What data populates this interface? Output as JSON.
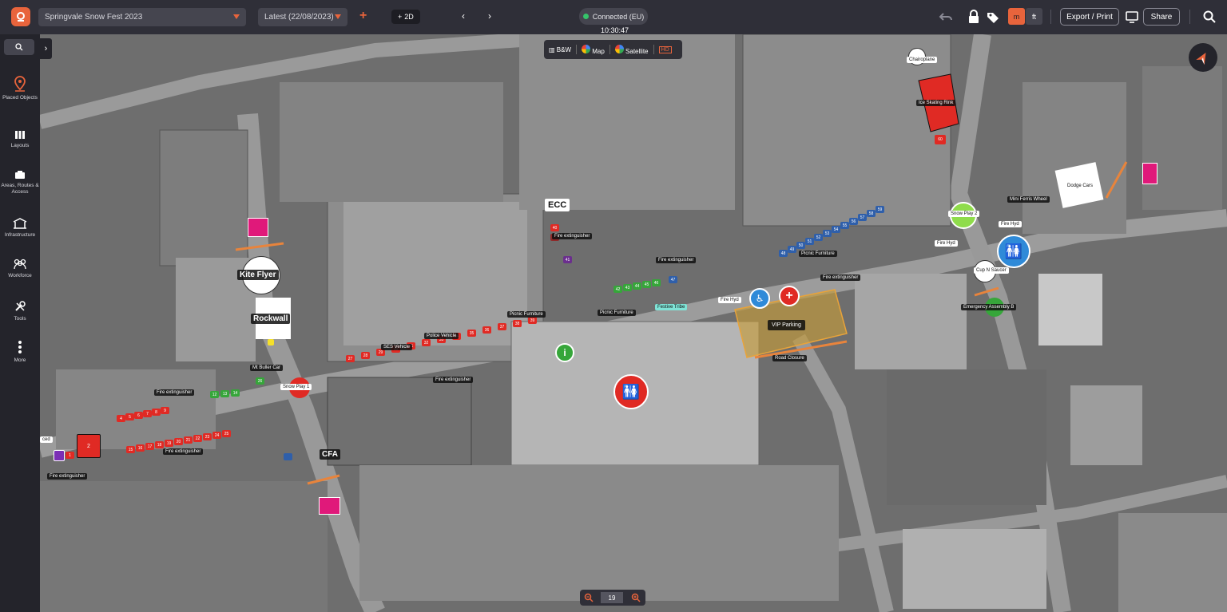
{
  "header": {
    "project": "Springvale Snow Fest 2023",
    "version": "Latest (22/08/2023)",
    "mode": "2D",
    "connection": "Connected (EU)",
    "time": "10:30:47",
    "units": [
      "m",
      "ft"
    ],
    "export_label": "Export / Print",
    "share_label": "Share",
    "accent": "#e8643c"
  },
  "sidebar": {
    "items": [
      {
        "label": "Placed Objects",
        "icon": "pin-icon"
      },
      {
        "label": "Layouts",
        "icon": "layouts-icon"
      },
      {
        "label": "Areas, Routes & Access",
        "icon": "areas-icon"
      },
      {
        "label": "Infrastructure",
        "icon": "infrastructure-icon"
      },
      {
        "label": "Workforce",
        "icon": "workforce-icon"
      },
      {
        "label": "Tools",
        "icon": "tools-icon"
      },
      {
        "label": "More",
        "icon": "more-icon"
      }
    ]
  },
  "map_type": {
    "bw": "B&W",
    "map": "Map",
    "satellite": "Satellite",
    "hd": "HD"
  },
  "zoom": {
    "level": "19"
  },
  "map_labels": {
    "chairoplane": "Chairoplane",
    "ice_rink": "Ice Skating Rink",
    "mini_ferris": "Mini Ferris Wheel",
    "dodge_cars": "Dodge Cars",
    "snow_play_2": "Snow Play 2",
    "fire_hyd_1": "Fire Hyd",
    "fire_hyd_2": "Fire Hyd",
    "fire_hyd_3": "Fire Hyd",
    "cup_n_saucer": "Cup N Saucer",
    "emergency": "Emergency Assembly B",
    "ecc": "ECC",
    "fire_ext_1": "Fire extinguisher",
    "fire_ext_2": "Fire extinguisher",
    "fire_ext_3": "Fire extinguisher",
    "fire_ext_4": "Fire extinguisher",
    "fire_ext_5": "Fire extinguisher",
    "fire_ext_6": "Fire extinguisher",
    "fire_ext_7": "Fire extinguisher",
    "picnic_1": "Picnic Furniture",
    "picnic_2": "Picnic Furniture",
    "picnic_3": "Picnic Furniture",
    "festive_tribe": "Festive Tribe",
    "vip_parking": "VIP Parking",
    "road_closure": "Road Closure",
    "kite_flyer": "Kite Flyer",
    "rockwall": "Rockwall",
    "mt_buller": "Mt Buller Car",
    "snow_play_1": "Snow Play 1",
    "ses_vehicle": "SES Vehicle",
    "police_vehicle": "Police Vehicle",
    "cfa": "CFA",
    "partial_left": "ced"
  },
  "markers": {
    "red_row_left": [
      "4",
      "5",
      "6",
      "7",
      "8",
      "9"
    ],
    "green_row_left": [
      "12",
      "13",
      "14"
    ],
    "red_row_bottom": [
      "15",
      "16",
      "17",
      "18",
      "19",
      "20",
      "21",
      "22",
      "23",
      "24",
      "25"
    ],
    "green_street": [
      "42",
      "43",
      "44",
      "45",
      "46"
    ],
    "red_street": [
      "27",
      "28",
      "29",
      "30",
      "31",
      "32",
      "33",
      "34",
      "35",
      "36",
      "37",
      "38",
      "39"
    ],
    "right_group": [
      "48",
      "49",
      "50",
      "51",
      "52",
      "53",
      "54",
      "55",
      "56",
      "57",
      "58",
      "59"
    ],
    "tag_60": "60",
    "tag_40": "40",
    "tag_41": "41",
    "tag_47": "47",
    "tag_26": "26",
    "tag_1": "1",
    "tag_2": "2"
  }
}
